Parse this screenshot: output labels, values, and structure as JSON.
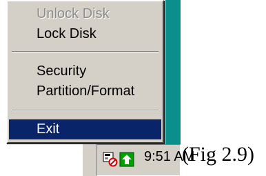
{
  "context_menu": {
    "items": [
      {
        "label": "Unlock Disk",
        "state": "disabled"
      },
      {
        "label": "Lock Disk",
        "state": "normal"
      },
      {
        "label": "Security",
        "state": "normal"
      },
      {
        "label": "Partition/Format",
        "state": "normal"
      },
      {
        "label": "Exit",
        "state": "selected"
      }
    ]
  },
  "taskbar": {
    "tray_icons": [
      "disk-lock-icon",
      "update-arrow-icon"
    ],
    "clock": "9:51 AM"
  },
  "caption": "(Fig 2.9)",
  "colors": {
    "menu_background": "#d4d0c8",
    "selection_highlight": "#0a246a",
    "desktop_teal": "#0b8f8c",
    "disabled_text": "#8c8c8c"
  }
}
